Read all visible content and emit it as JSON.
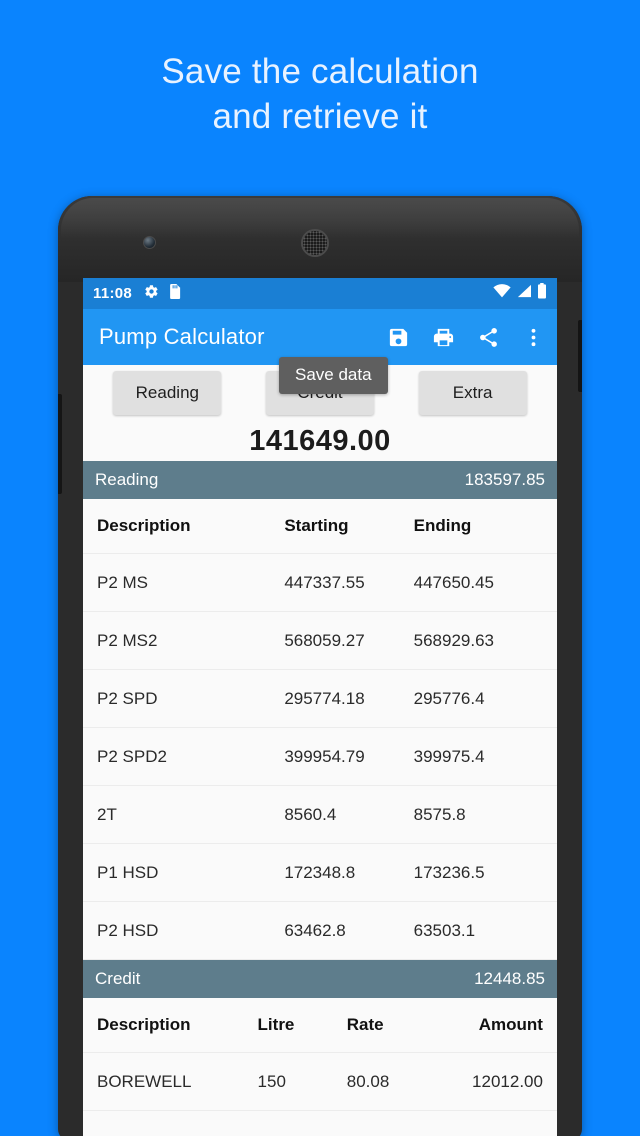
{
  "promo": {
    "line1": "Save the calculation",
    "line2": "and retrieve it"
  },
  "status_bar": {
    "time": "11:08",
    "icons": [
      "gear-icon",
      "sd-card-icon"
    ],
    "right_icons": [
      "wifi-icon",
      "signal-icon",
      "battery-icon"
    ]
  },
  "app_bar": {
    "title": "Pump Calculator",
    "actions": [
      "save-icon",
      "print-icon",
      "share-icon",
      "overflow-menu-icon"
    ]
  },
  "tabs": [
    {
      "label": "Reading"
    },
    {
      "label": "Credit"
    },
    {
      "label": "Extra"
    }
  ],
  "tooltip": {
    "text": "Save data"
  },
  "total": {
    "value": "141649.00"
  },
  "reading_section": {
    "title": "Reading",
    "amount": "183597.85",
    "columns": [
      "Description",
      "Starting",
      "Ending"
    ],
    "rows": [
      {
        "description": "P2 MS",
        "starting": "447337.55",
        "ending": "447650.45"
      },
      {
        "description": "P2 MS2",
        "starting": "568059.27",
        "ending": "568929.63"
      },
      {
        "description": "P2 SPD",
        "starting": "295774.18",
        "ending": "295776.4"
      },
      {
        "description": "P2 SPD2",
        "starting": "399954.79",
        "ending": "399975.4"
      },
      {
        "description": "2T",
        "starting": "8560.4",
        "ending": "8575.8"
      },
      {
        "description": "P1 HSD",
        "starting": "172348.8",
        "ending": "173236.5"
      },
      {
        "description": "P2 HSD",
        "starting": "63462.8",
        "ending": "63503.1"
      }
    ]
  },
  "credit_section": {
    "title": "Credit",
    "amount": "12448.85",
    "columns": [
      "Description",
      "Litre",
      "Rate",
      "Amount"
    ],
    "rows": [
      {
        "description": "BOREWELL",
        "litre": "150",
        "rate": "80.08",
        "amount": "12012.00"
      }
    ]
  },
  "colors": {
    "background_blue": "#0a84fe",
    "appbar_blue": "#2196f3",
    "statusbar_blue": "#1a7fd4",
    "section_header": "#5e7d8c",
    "tab_button": "#e0e0e0",
    "tooltip": "#5f5f5f",
    "screen_background": "#fafafa"
  }
}
